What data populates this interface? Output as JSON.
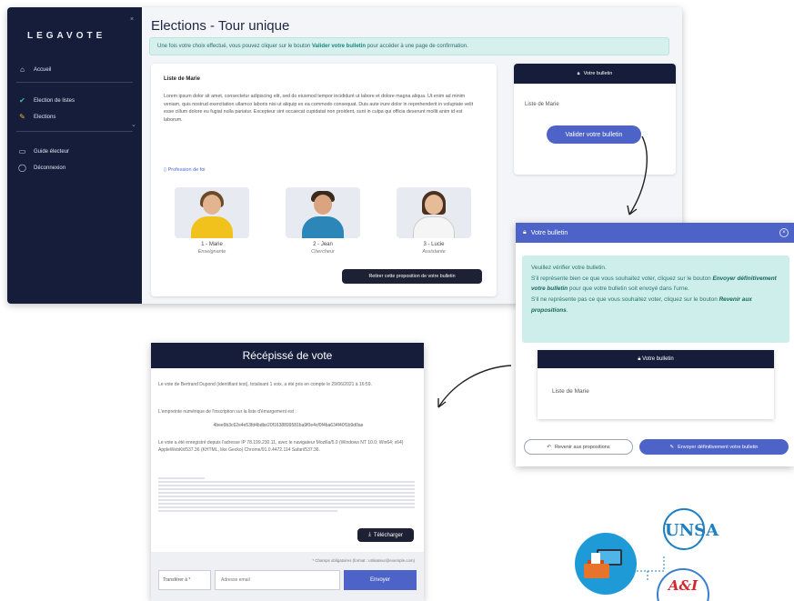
{
  "sidebar": {
    "logo": "LEGAVOTE",
    "items": [
      {
        "label": "Accueil",
        "icon": "home-icon"
      },
      {
        "label": "Election de listes",
        "icon": "check-icon"
      },
      {
        "label": "Elections",
        "icon": "ballot-icon"
      },
      {
        "label": "Guide électeur",
        "icon": "document-icon"
      },
      {
        "label": "Déconnexion",
        "icon": "logout-icon"
      }
    ]
  },
  "main": {
    "title": "Elections - Tour unique",
    "info_prefix": "Une fois votre choix effectué, vous pouvez cliquer sur le bouton ",
    "info_bold": "Valider votre bulletin",
    "info_suffix": " pour accéder à une page de confirmation.",
    "list_name": "Liste de Marie",
    "lorem": "Lorem ipsum dolor sit amet, consectetur adipiscing elit, sed do eiusmod tempor incididunt ut labore et dolore magna aliqua. Ut enim ad minim veniam, quis nostrud exercitation ullamco laboris nisi ut aliquip ex ea commodo consequat. Duis aute irure dolor in reprehenderit in voluptate velit esse cillum dolore eu fugiat nulla pariatur. Excepteur sint occaecat cupidatat non proident, sunt in culpa qui officia deserunt mollit anim id est laborum.",
    "profession_link": "Profession de foi",
    "candidates": [
      {
        "name": "1 - Marie",
        "role": "Enseignante"
      },
      {
        "name": "2 - Jean",
        "role": "Chercheur"
      },
      {
        "name": "3 - Lucie",
        "role": "Assistante"
      }
    ],
    "remove_button": "Retirer cette proposition de votre bulletin"
  },
  "ballot": {
    "header": "Votre bulletin",
    "list": "Liste de Marie",
    "validate_button": "Valider votre bulletin"
  },
  "modal": {
    "title": "Votre bulletin",
    "line1": "Veuillez vérifier votre bulletin.",
    "line2_prefix": "S'il représente bien ce que vous souhaitez voter, cliquez sur le bouton ",
    "line2_bold": "Envoyer définitivement votre bulletin",
    "line2_suffix": " pour que votre bulletin soit envoyé dans l'urne.",
    "line3_prefix": "S'il ne représente pas ce que vous souhaitez voter, cliquez sur le bouton ",
    "line3_bold": "Revenir aux propositions",
    "line3_suffix": ".",
    "inner_header": "Votre bulletin",
    "inner_list": "Liste de Marie",
    "back_button": "Revenir aux propositions",
    "send_button": "Envoyer définitivement votre bulletin"
  },
  "receipt": {
    "title": "Récépissé de vote",
    "p1": "Le vote de Bertrand Dupond (identifiant test), totalisant 1 voix, a été pris en compte le 29/06/2021 à 16:59.",
    "p2": "L'empreinte numérique de l'inscription sur la liste d'émargement est :",
    "hash": "4bee9b3c62e4e53fd4bdbe20f1638899581ba9f0e4cf0f4ba634f40f1b9d0ae",
    "p3": "Le vote a été enregistré depuis l'adresse IP 78.199.230.11, avec le navigateur Mozilla/5.0 (Windows NT 10.0; Win64; x64) AppleWebKit/537.36 (KHTML, like Gecko) Chrome/91.0.4472.114 Safari/537.36.",
    "download_button": "Télécharger",
    "required_note": "* Champs obligatoires (format : utilisateur@exemple.com)",
    "transfer_label": "Transférer à *",
    "email_placeholder": "Adresse email",
    "send_button": "Envoyer"
  },
  "logos": {
    "unsa": "UNSA",
    "ai": "A&I"
  },
  "colors": {
    "navy": "#161d3a",
    "accent_blue": "#4d63c7",
    "teal_banner": "#d6f0ee"
  }
}
